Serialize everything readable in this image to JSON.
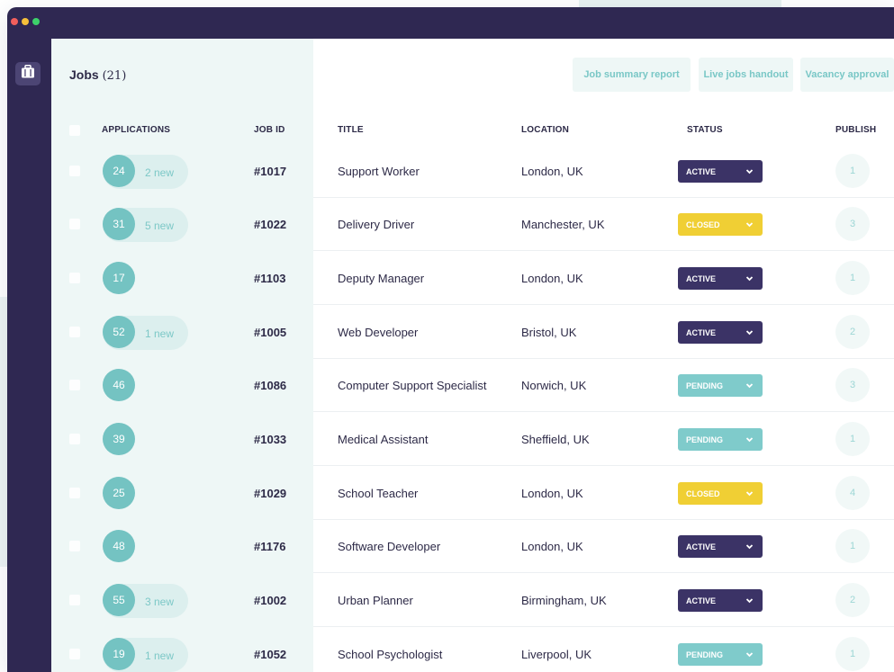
{
  "jobs": {
    "title": "Jobs",
    "count": "(21)"
  },
  "toolbar": {
    "job_summary": "Job summary report",
    "live_jobs": "Live jobs handout",
    "vacancy": "Vacancy approval"
  },
  "columns": {
    "applications": "APPLICATIONS",
    "job_id": "JOB ID",
    "title": "TITLE",
    "location": "LOCATION",
    "status": "STATUS",
    "publish": "PUBLISH"
  },
  "icons": {
    "sidebar": "briefcase-icon",
    "status_dropdown": "chevron-down-icon"
  },
  "colors": {
    "active": "#3b3366",
    "closed": "#f0cf34",
    "pending": "#7fcbcb",
    "accent": "#74c3c2",
    "sidebar": "#2f2852"
  },
  "rows": [
    {
      "applications": "24",
      "new": "2 new",
      "id": "#1017",
      "title": "Support Worker",
      "location": "London, UK",
      "status": "ACTIVE",
      "publish": "1"
    },
    {
      "applications": "31",
      "new": "5 new",
      "id": "#1022",
      "title": "Delivery Driver",
      "location": "Manchester, UK",
      "status": "CLOSED",
      "publish": "3"
    },
    {
      "applications": "17",
      "new": "",
      "id": "#1103",
      "title": "Deputy Manager",
      "location": "London, UK",
      "status": "ACTIVE",
      "publish": "1"
    },
    {
      "applications": "52",
      "new": "1 new",
      "id": "#1005",
      "title": "Web Developer",
      "location": "Bristol, UK",
      "status": "ACTIVE",
      "publish": "2"
    },
    {
      "applications": "46",
      "new": "",
      "id": "#1086",
      "title": "Computer Support Specialist",
      "location": "Norwich, UK",
      "status": "PENDING",
      "publish": "3"
    },
    {
      "applications": "39",
      "new": "",
      "id": "#1033",
      "title": "Medical Assistant",
      "location": "Sheffield, UK",
      "status": "PENDING",
      "publish": "1"
    },
    {
      "applications": "25",
      "new": "",
      "id": "#1029",
      "title": "School Teacher",
      "location": "London, UK",
      "status": "CLOSED",
      "publish": "4"
    },
    {
      "applications": "48",
      "new": "",
      "id": "#1176",
      "title": "Software Developer",
      "location": "London, UK",
      "status": "ACTIVE",
      "publish": "1"
    },
    {
      "applications": "55",
      "new": "3 new",
      "id": "#1002",
      "title": "Urban Planner",
      "location": "Birmingham, UK",
      "status": "ACTIVE",
      "publish": "2"
    },
    {
      "applications": "19",
      "new": "1 new",
      "id": "#1052",
      "title": "School Psychologist",
      "location": "Liverpool, UK",
      "status": "PENDING",
      "publish": "1"
    }
  ]
}
